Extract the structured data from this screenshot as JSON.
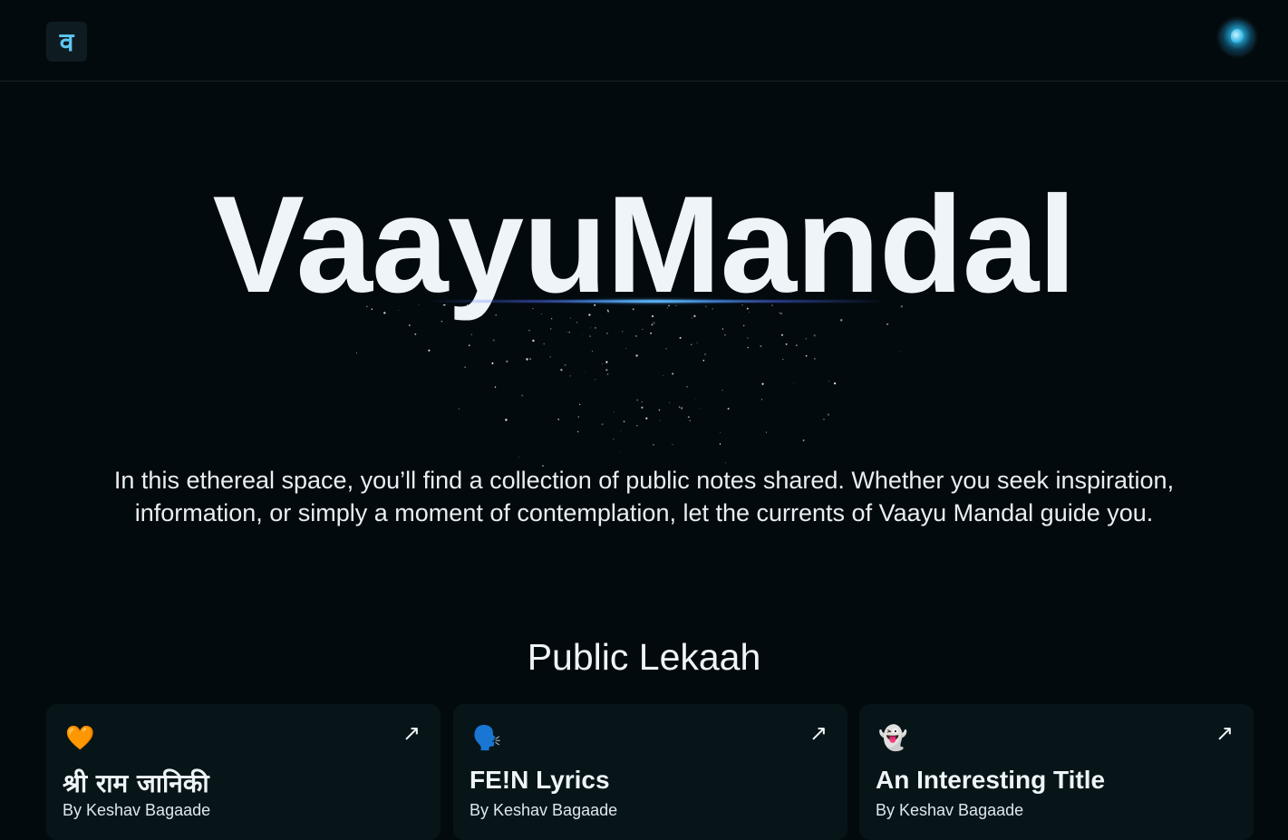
{
  "header": {
    "logo_glyph": "व",
    "avatar_label": "profile-avatar"
  },
  "hero": {
    "title": "VaayuMandal",
    "tagline": "In this ethereal space, you’ll find a collection of public notes shared. Whether you seek inspiration, information, or simply a moment of contemplation, let the currents of Vaayu Mandal guide you."
  },
  "section": {
    "title": "Public Lekaah"
  },
  "cards": [
    {
      "emoji": "🧡",
      "title": "श्री राम जानिकी",
      "author": "By Keshav Bagaade",
      "arrow": "↗"
    },
    {
      "emoji": "🗣️",
      "title": "FE!N Lyrics",
      "author": "By Keshav Bagaade",
      "arrow": "↗"
    },
    {
      "emoji": "👻",
      "title": "An Interesting Title",
      "author": "By Keshav Bagaade",
      "arrow": "↗"
    }
  ],
  "colors": {
    "background": "#030a0d",
    "card_background": "#071519",
    "logo_accent": "#5ec8f2",
    "glow_accent": "#5ab8ff"
  }
}
